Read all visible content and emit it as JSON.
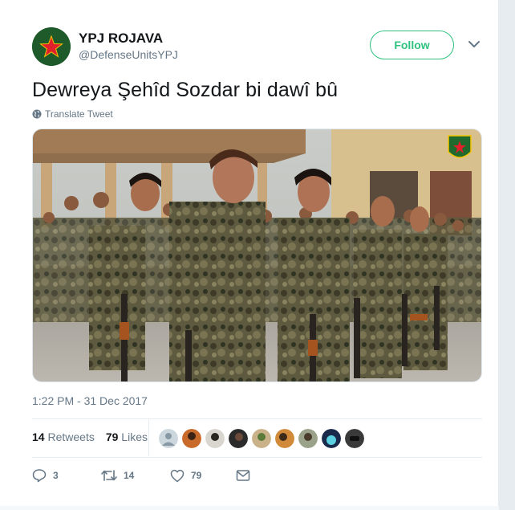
{
  "account": {
    "name": "YPJ ROJAVA",
    "handle": "@DefenseUnitsYPJ"
  },
  "follow_label": "Follow",
  "tweet": {
    "text": "Dewreya Şehîd Sozdar bi dawî bû",
    "translate_label": "Translate Tweet",
    "timestamp": "1:22 PM - 31 Dec 2017"
  },
  "stats": {
    "retweets_count": "14",
    "retweets_label": "Retweets",
    "likes_count": "79",
    "likes_label": "Likes"
  },
  "actions": {
    "reply_count": "3",
    "retweet_count": "14",
    "like_count": "79"
  },
  "icons": {
    "avatar": "red-star-emblem",
    "caret": "chevron-down-icon",
    "translate": "globe-icon",
    "reply": "reply-icon",
    "retweet": "retweet-icon",
    "like": "heart-icon",
    "dm": "envelope-icon"
  },
  "colors": {
    "follow_accent": "#2ec27e",
    "text_secondary": "#657786",
    "avatar_bg": "#1e5a2a",
    "star": "#e0202a"
  }
}
